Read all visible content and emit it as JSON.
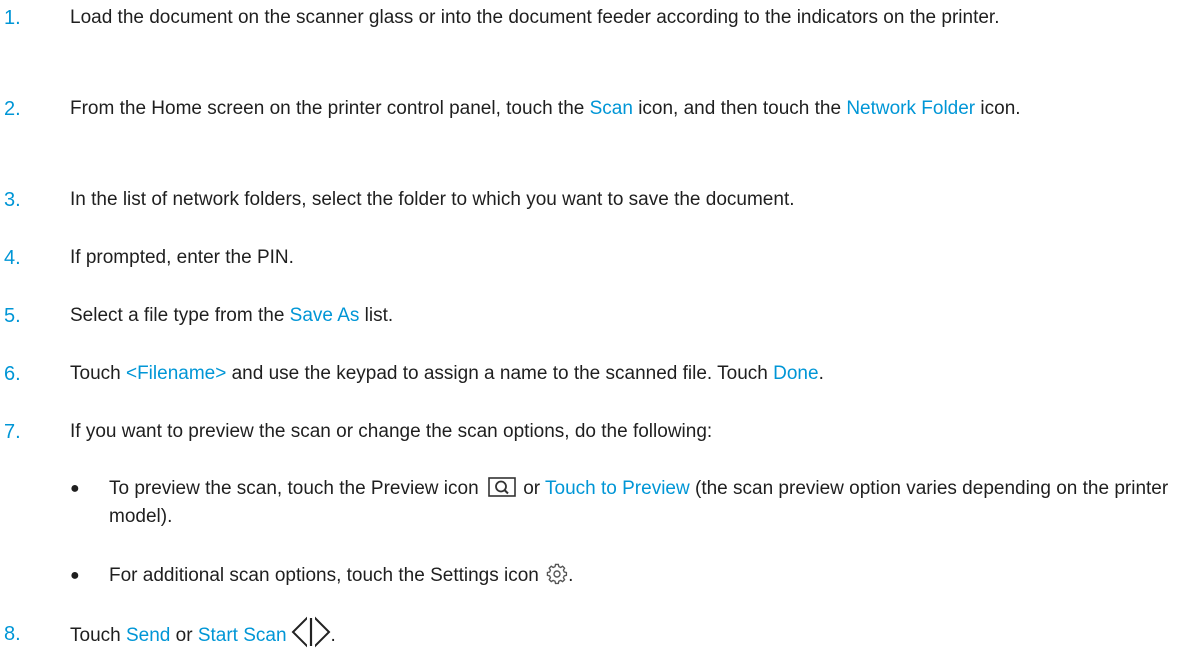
{
  "colors": {
    "accent": "#0096d6",
    "text": "#1f1f1f"
  },
  "steps": [
    {
      "num": "1.",
      "text": "Load the document on the scanner glass or into the document feeder according to the indicators on the printer."
    },
    {
      "num": "2.",
      "t1": "From the Home screen on the printer control panel, touch the ",
      "h1": "Scan",
      "t2": " icon, and then touch the ",
      "h2": "Network Folder",
      "t3": " icon."
    },
    {
      "num": "3.",
      "text": "In the list of network folders, select the folder to which you want to save the document."
    },
    {
      "num": "4.",
      "text": "If prompted, enter the PIN."
    },
    {
      "num": "5.",
      "t1": "Select a file type from the ",
      "h1": "Save As",
      "t2": " list."
    },
    {
      "num": "6.",
      "t1": "Touch ",
      "h1": "<Filename>",
      "t2": " and use the keypad to assign a name to the scanned file. Touch ",
      "h2": "Done",
      "t3": "."
    },
    {
      "num": "7.",
      "text": "If you want to preview the scan or change the scan options, do the following:",
      "bullets": [
        {
          "dot": "●",
          "t1": "To preview the scan, touch the Preview icon ",
          "icon": "preview-icon",
          "t2": " or ",
          "h1": "Touch to Preview",
          "t3": " (the scan preview option varies depending on the printer model)."
        },
        {
          "dot": "●",
          "t1": "For additional scan options, touch the Settings icon ",
          "icon": "gear-icon",
          "t2": "."
        }
      ]
    },
    {
      "num": "8.",
      "t1": "Touch ",
      "h1": "Send",
      "t2": " or ",
      "h2": "Start Scan",
      "icon": "start-icon",
      "t3": "."
    }
  ]
}
